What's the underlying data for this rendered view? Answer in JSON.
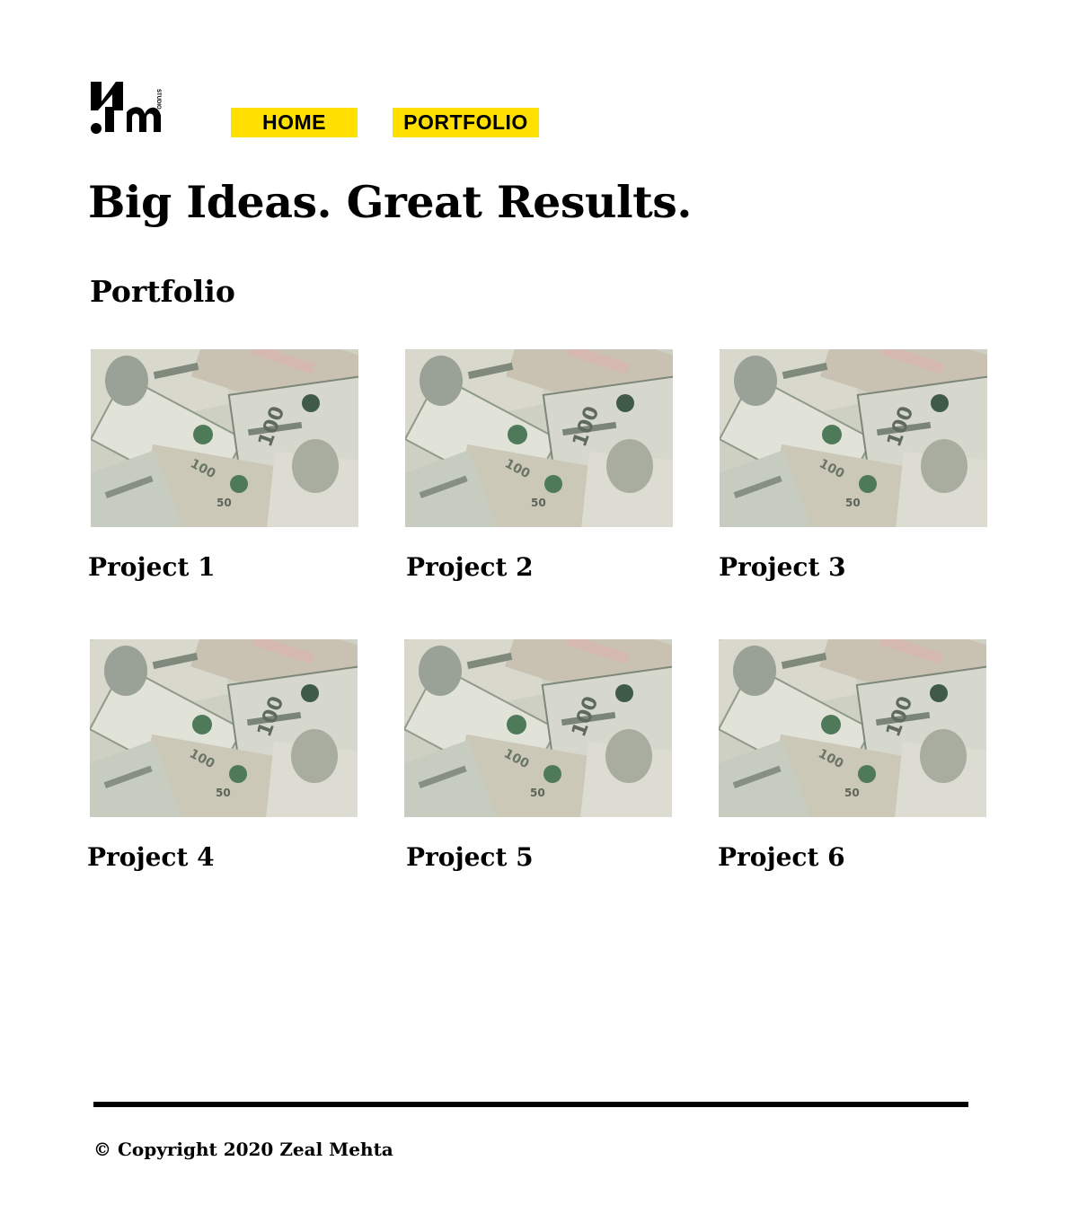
{
  "header": {
    "logo_icon": "sm-studio-logo",
    "logo_tagline": "STUDIO",
    "nav": [
      {
        "label": "HOME"
      },
      {
        "label": "PORTFOLIO"
      }
    ],
    "accent_color": "#ffe000"
  },
  "hero": {
    "title": "Big Ideas. Great Results."
  },
  "portfolio": {
    "heading": "Portfolio",
    "projects": [
      {
        "title": "Project 1",
        "image": "money-photo"
      },
      {
        "title": "Project 2",
        "image": "money-photo"
      },
      {
        "title": "Project 3",
        "image": "money-photo"
      },
      {
        "title": "Project 4",
        "image": "money-photo"
      },
      {
        "title": "Project 5",
        "image": "money-photo"
      },
      {
        "title": "Project 6",
        "image": "money-photo"
      }
    ]
  },
  "footer": {
    "copyright": "© Copyright 2020 Zeal Mehta"
  }
}
